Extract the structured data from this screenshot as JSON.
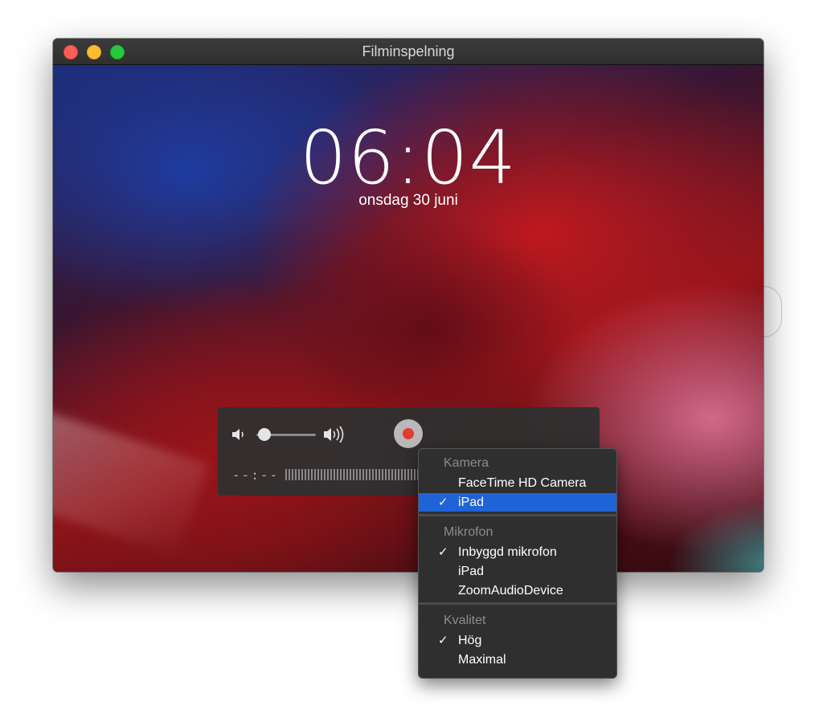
{
  "window": {
    "title": "Filminspelning"
  },
  "lockscreen": {
    "time": "06:04",
    "date": "onsdag 30 juni"
  },
  "controls": {
    "timecode": "--:--",
    "volume_level": 0.05
  },
  "menu": {
    "sections": [
      {
        "header": "Kamera",
        "items": [
          {
            "label": "FaceTime HD Camera",
            "checked": false
          },
          {
            "label": "iPad",
            "checked": true
          }
        ]
      },
      {
        "header": "Mikrofon",
        "items": [
          {
            "label": "Inbyggd mikrofon",
            "checked": true
          },
          {
            "label": "iPad",
            "checked": false
          },
          {
            "label": "ZoomAudioDevice",
            "checked": false
          }
        ]
      },
      {
        "header": "Kvalitet",
        "items": [
          {
            "label": "Hög",
            "checked": true
          },
          {
            "label": "Maximal",
            "checked": false
          }
        ]
      }
    ],
    "check_glyph": "✓"
  },
  "colors": {
    "record": "#e53b30",
    "menu_highlight": "#1f63d6"
  }
}
